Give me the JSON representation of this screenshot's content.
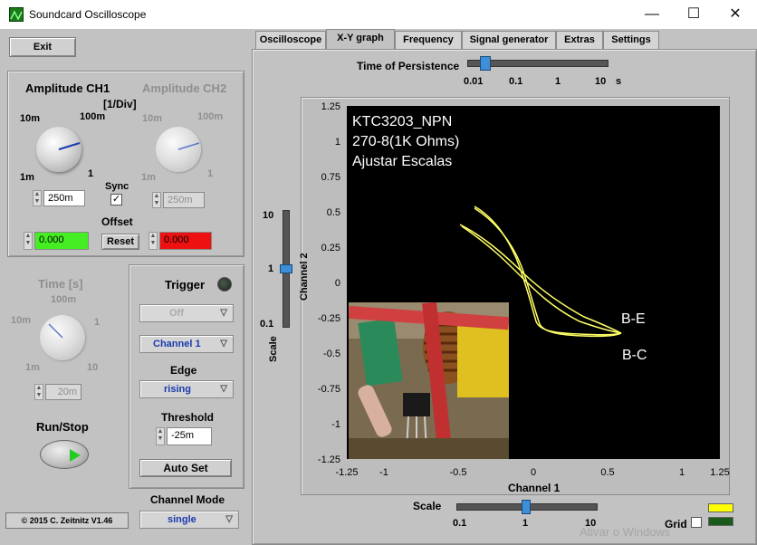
{
  "window": {
    "title": "Soundcard Oscilloscope"
  },
  "controls": {
    "exit": "Exit",
    "run_stop": "Run/Stop",
    "auto_set": "Auto Set",
    "reset": "Reset"
  },
  "ch1": {
    "title": "Amplitude CH1",
    "unit": "[1/Div]",
    "labels": [
      "10m",
      "100m",
      "1m",
      "1"
    ],
    "value": "250m"
  },
  "ch2": {
    "title": "Amplitude CH2",
    "labels": [
      "10m",
      "100m",
      "1m",
      "1"
    ],
    "value": "250m"
  },
  "sync": {
    "label": "Sync",
    "checked": true
  },
  "offset": {
    "label": "Offset",
    "ch1": "0.000",
    "ch2": "0.000"
  },
  "time": {
    "title": "Time [s]",
    "labels": [
      "100m",
      "10m",
      "1",
      "1m",
      "10"
    ],
    "value": "20m"
  },
  "trigger": {
    "title": "Trigger",
    "mode": "Off",
    "channel": "Channel 1",
    "edge_label": "Edge",
    "edge": "rising",
    "threshold_label": "Threshold",
    "threshold": "-25m"
  },
  "channel_mode": {
    "label": "Channel Mode",
    "value": "single"
  },
  "copyright": "© 2015  C. Zeitnitz V1.46",
  "tabs": [
    "Oscilloscope",
    "X-Y graph",
    "Frequency",
    "Signal generator",
    "Extras",
    "Settings"
  ],
  "persistence": {
    "label": "Time of Persistence",
    "ticks": [
      "0.01",
      "0.1",
      "1",
      "10"
    ],
    "unit": "s"
  },
  "scale_v": {
    "label": "Scale",
    "ticks": [
      "10",
      "1",
      "0.1"
    ]
  },
  "scale_h": {
    "label": "Scale",
    "ticks": [
      "0.1",
      "1",
      "10"
    ]
  },
  "graph": {
    "annotations": [
      "KTC3203_NPN",
      "270-8(1K Ohms)",
      "Ajustar Escalas"
    ],
    "curve_labels": [
      "B-E",
      "B-C"
    ],
    "y_ticks": [
      "1.25",
      "1",
      "0.75",
      "0.5",
      "0.25",
      "0",
      "-0.25",
      "-0.5",
      "-0.75",
      "-1",
      "-1.25"
    ],
    "x_ticks": [
      "-1.25",
      "-1",
      "-0.5",
      "0",
      "0.5",
      "1",
      "1.25"
    ],
    "xlabel": "Channel 1",
    "ylabel": "Channel 2",
    "trace_color": "#ffff66"
  },
  "grid": {
    "label": "Grid"
  },
  "watermark": "Ativar o Windows"
}
